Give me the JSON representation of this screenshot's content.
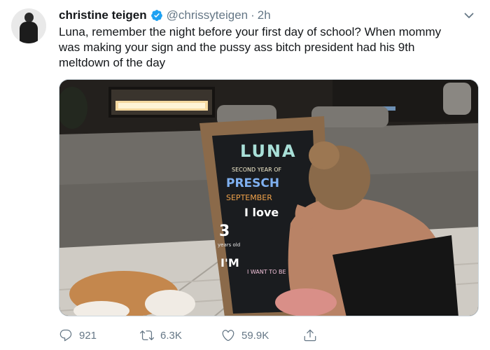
{
  "tweet": {
    "display_name": "christine teigen",
    "handle": "@chrissyteigen",
    "separator": "·",
    "time": "2h",
    "text_lines": [
      "Luna, remember the night before your first day of school? When mommy",
      "was making your sign and the pussy ass bitch president had his 9th",
      "meltdown of the day"
    ],
    "icons": {
      "verified": "verified-badge-icon",
      "more": "chevron-down-icon",
      "reply": "reply-icon",
      "retweet": "retweet-icon",
      "like": "heart-icon",
      "share": "share-icon"
    },
    "colors": {
      "verified": "#1da1f2",
      "muted": "#657786",
      "text": "#14171a"
    }
  },
  "media": {
    "chalkboard_lines": [
      "LUNA",
      "SECOND YEAR OF",
      "PRESCH",
      "SEPTEMBER",
      "I love",
      "3",
      "years old",
      "I'M",
      "I WANT TO BE"
    ]
  },
  "actions": {
    "reply_count": "921",
    "retweet_count": "6.3K",
    "like_count": "59.9K"
  }
}
